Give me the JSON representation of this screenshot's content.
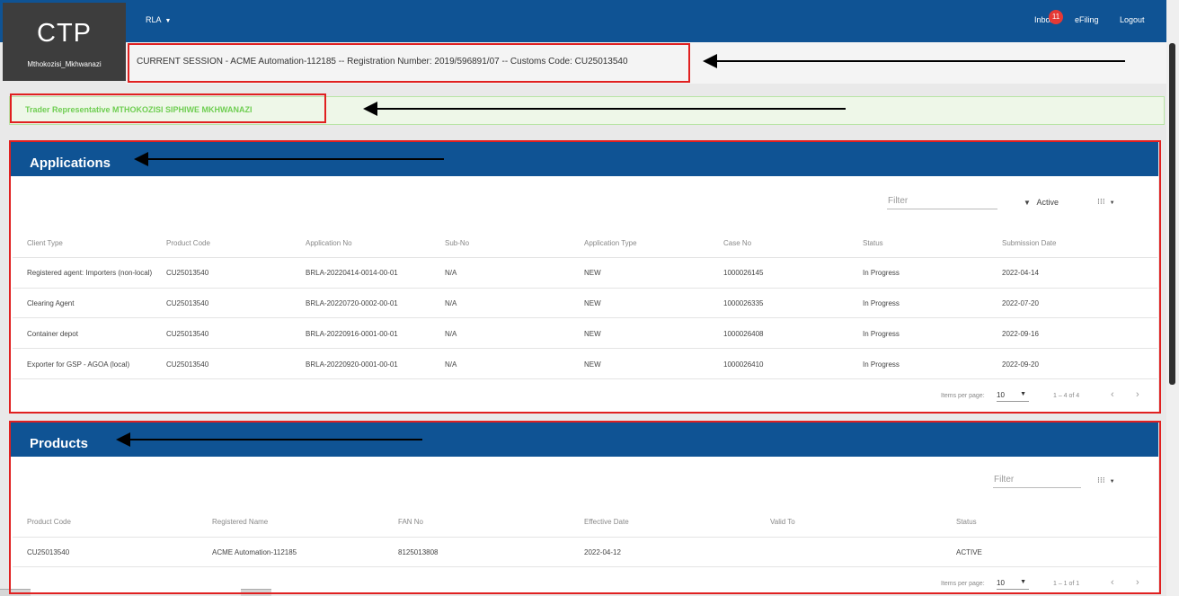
{
  "header": {
    "logo": "CTP",
    "username": "Mthokozisi_Mkhwanazi",
    "nav_menu": "RLA",
    "inbox_label": "Inbox",
    "inbox_count": "11",
    "efiling_label": "eFiling",
    "logout_label": "Logout"
  },
  "session": {
    "text": "CURRENT SESSION - ACME Automation-112185 -- Registration Number: 2019/596891/07 -- Customs Code: CU25013540"
  },
  "trader": {
    "text": "Trader Representative  MTHOKOZISI SIPHIWE MKHWANAZI"
  },
  "applications": {
    "title": "Applications",
    "filter_placeholder": "Filter",
    "active_label": "Active",
    "columns": [
      "Client Type",
      "Product Code",
      "Application No",
      "Sub-No",
      "Application Type",
      "Case No",
      "Status",
      "Submission Date"
    ],
    "rows": [
      [
        "Registered agent: Importers (non-local)",
        "CU25013540",
        "BRLA-20220414-0014-00-01",
        "N/A",
        "NEW",
        "1000026145",
        "In Progress",
        "2022-04-14"
      ],
      [
        "Clearing Agent",
        "CU25013540",
        "BRLA-20220720-0002-00-01",
        "N/A",
        "NEW",
        "1000026335",
        "In Progress",
        "2022-07-20"
      ],
      [
        "Container depot",
        "CU25013540",
        "BRLA-20220916-0001-00-01",
        "N/A",
        "NEW",
        "1000026408",
        "In Progress",
        "2022-09-16"
      ],
      [
        "Exporter for GSP - AGOA (local)",
        "CU25013540",
        "BRLA-20220920-0001-00-01",
        "N/A",
        "NEW",
        "1000026410",
        "In Progress",
        "2022-09-20"
      ]
    ],
    "items_per_page_label": "Items per page:",
    "items_per_page": "10",
    "range": "1 – 4 of 4"
  },
  "products": {
    "title": "Products",
    "filter_placeholder": "Filter",
    "columns": [
      "Product Code",
      "Registered Name",
      "FAN No",
      "Effective Date",
      "Valid To",
      "Status"
    ],
    "rows": [
      [
        "CU25013540",
        "ACME Automation-112185",
        "8125013808",
        "2022-04-12",
        "",
        "ACTIVE"
      ]
    ],
    "items_per_page_label": "Items per page:",
    "items_per_page": "10",
    "range": "1 – 1 of 1"
  },
  "icons": {
    "nav_caret": "chevron-down-icon",
    "filter": "filter-icon",
    "columns": "column-grid-icon",
    "prev": "chevron-left-icon",
    "next": "chevron-right-icon",
    "annotation": "arrow-left-icon"
  },
  "colors": {
    "primary": "#0f5394",
    "logo_bg": "#3d3d3d",
    "trader_text": "#6fce52",
    "badge": "#e53935",
    "annotation_box": "#e02020"
  }
}
